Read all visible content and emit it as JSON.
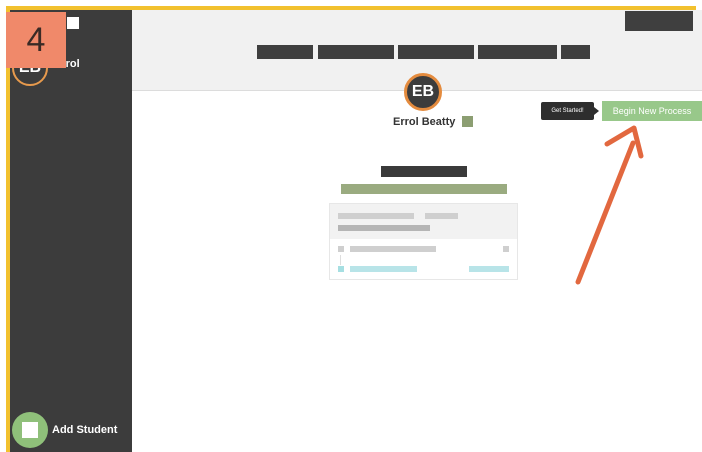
{
  "step": {
    "number": "4"
  },
  "sidebar": {
    "user_initials": "EB",
    "user_name": "Errol",
    "add_student_label": "Add Student"
  },
  "profile": {
    "initials": "EB",
    "name": "Errol Beatty"
  },
  "actions": {
    "tooltip": "Get Started!",
    "begin_button": "Begin New Process"
  },
  "colors": {
    "sidebar": "#3c3c3c",
    "accent_border": "#f2c12e",
    "step_badge": "#f0896a",
    "begin_button": "#98c88a",
    "arrow": "#e2683f"
  },
  "icons": [
    "plus-icon",
    "arrow-icon"
  ]
}
